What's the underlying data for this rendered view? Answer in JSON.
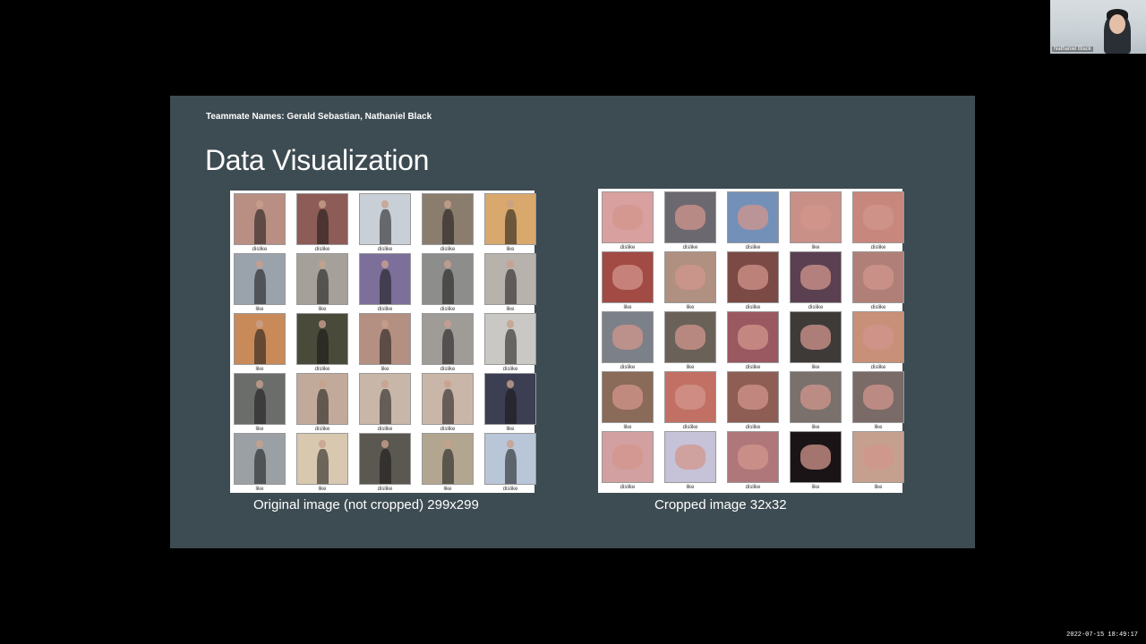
{
  "slide": {
    "teammates": "Teammate Names: Gerald Sebastian, Nathaniel Black",
    "title": "Data Visualization",
    "left_caption": "Original image (not cropped) 299x299",
    "right_caption": "Cropped image 32x32"
  },
  "left_grid": {
    "labels": [
      "dislike",
      "dislike",
      "dislike",
      "dislike",
      "like",
      "like",
      "like",
      "dislike",
      "dislike",
      "like",
      "like",
      "dislike",
      "like",
      "dislike",
      "dislike",
      "like",
      "dislike",
      "dislike",
      "dislike",
      "like",
      "like",
      "like",
      "dislike",
      "like",
      "dislike"
    ],
    "colors": [
      "#b98f83",
      "#8e5c56",
      "#c9cfd6",
      "#8b7d6d",
      "#d9a86c",
      "#9aa2ac",
      "#a5a09a",
      "#7c6f9a",
      "#8d8e8c",
      "#b8b2ad",
      "#c98a5a",
      "#4a4a3a",
      "#b49082",
      "#9f9c98",
      "#c9c8c4",
      "#6b6d6a",
      "#c2aa9a",
      "#c8b7a8",
      "#cab6a8",
      "#3c3e52",
      "#9aa0a4",
      "#d8c8b0",
      "#5a5850",
      "#b2a690",
      "#b9c6d8"
    ]
  },
  "right_grid": {
    "labels": [
      "dislike",
      "dislike",
      "dislike",
      "like",
      "dislike",
      "like",
      "like",
      "dislike",
      "dislike",
      "dislike",
      "dislike",
      "like",
      "dislike",
      "like",
      "dislike",
      "like",
      "dislike",
      "dislike",
      "like",
      "like",
      "dislike",
      "like",
      "dislike",
      "like",
      "like"
    ],
    "colors": [
      "#d9a0a0",
      "#6c6870",
      "#7390b8",
      "#c99088",
      "#c8877d",
      "#a24a44",
      "#b09080",
      "#7c4a44",
      "#5a4050",
      "#b08078",
      "#7c8088",
      "#6a6258",
      "#9a5860",
      "#3e3a38",
      "#c89078",
      "#8a6a58",
      "#c27064",
      "#8e5e54",
      "#7a706c",
      "#7a6a68",
      "#d2a0a0",
      "#c6c2d8",
      "#b0777a",
      "#1a1416",
      "#c6a08e"
    ]
  },
  "webcam": {
    "name": "Nathaniel Black"
  },
  "timestamp": "2022-07-15  18:49:17"
}
